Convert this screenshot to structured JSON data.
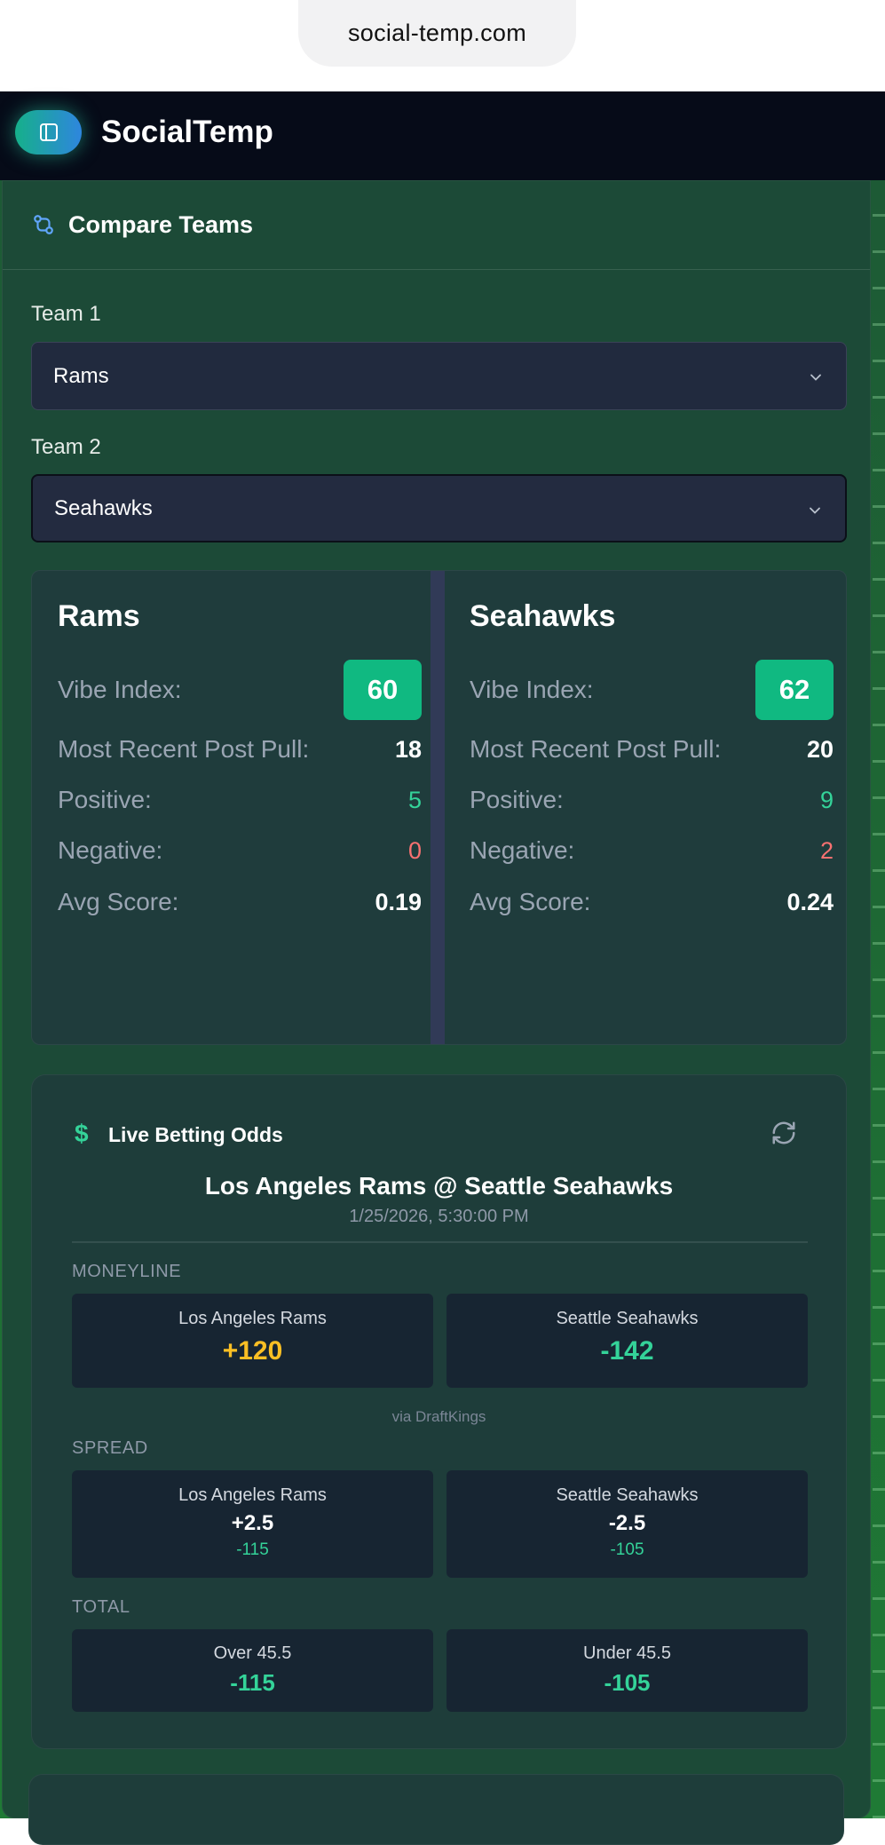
{
  "browser": {
    "url": "social-temp.com"
  },
  "app": {
    "brand": "SocialTemp"
  },
  "compare": {
    "title": "Compare Teams",
    "team1_label": "Team 1",
    "team1_value": "Rams",
    "team2_label": "Team 2",
    "team2_value": "Seahawks"
  },
  "stats": {
    "labels": {
      "vibe": "Vibe Index:",
      "recent": "Most Recent Post Pull:",
      "positive": "Positive:",
      "negative": "Negative:",
      "avg": "Avg Score:"
    },
    "team1": {
      "name": "Rams",
      "vibe": "60",
      "recent": "18",
      "positive": "5",
      "negative": "0",
      "avg": "0.19"
    },
    "team2": {
      "name": "Seahawks",
      "vibe": "62",
      "recent": "20",
      "positive": "9",
      "negative": "2",
      "avg": "0.24"
    }
  },
  "odds": {
    "icon": "$",
    "title": "Live Betting Odds",
    "matchup": "Los Angeles Rams @ Seattle Seahawks",
    "time": "1/25/2026, 5:30:00 PM",
    "moneyline": {
      "label": "MONEYLINE",
      "home_team": "Los Angeles Rams",
      "home_value": "+120",
      "away_team": "Seattle Seahawks",
      "away_value": "-142",
      "source": "via DraftKings"
    },
    "spread": {
      "label": "SPREAD",
      "home_team": "Los Angeles Rams",
      "home_line": "+2.5",
      "home_price": "-115",
      "away_team": "Seattle Seahawks",
      "away_line": "-2.5",
      "away_price": "-105"
    },
    "total": {
      "label": "TOTAL",
      "over_label": "Over 45.5",
      "over_price": "-115",
      "under_label": "Under 45.5",
      "under_price": "-105"
    }
  },
  "colors": {
    "accent": "#10b981",
    "positive": "#34d399",
    "negative": "#f87171",
    "gold": "#fbbf24"
  }
}
